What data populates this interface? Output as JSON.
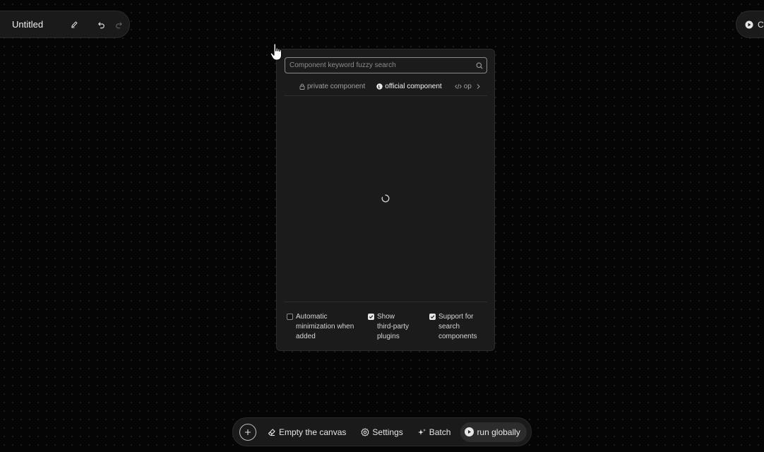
{
  "titlebar": {
    "title": "Untitled",
    "icons": [
      "edit-pencil-icon",
      "undo-icon",
      "redo-icon"
    ]
  },
  "topright": {
    "label": "Co",
    "icon": "run-icon"
  },
  "panel": {
    "search_placeholder": "Component keyword fuzzy search",
    "tabs": [
      {
        "label": "private component",
        "icon": "lock-icon",
        "active": false
      },
      {
        "label": "official component",
        "icon": "official-badge-icon",
        "active": true
      },
      {
        "label": "op",
        "icon": "code-icon",
        "active": false
      }
    ],
    "loading": true,
    "options": [
      {
        "label": "Automatic minimization when added",
        "checked": false
      },
      {
        "label": "Show third-party plugins",
        "checked": true
      },
      {
        "label": "Support for search components",
        "checked": true
      }
    ]
  },
  "bottombar": {
    "empty_label": "Empty the canvas",
    "settings_label": "Settings",
    "batch_label": "Batch",
    "run_label": "run globally"
  },
  "colors": {
    "background": "#050505",
    "panel": "#1b1b1b",
    "accent": "#e8e8e8"
  }
}
